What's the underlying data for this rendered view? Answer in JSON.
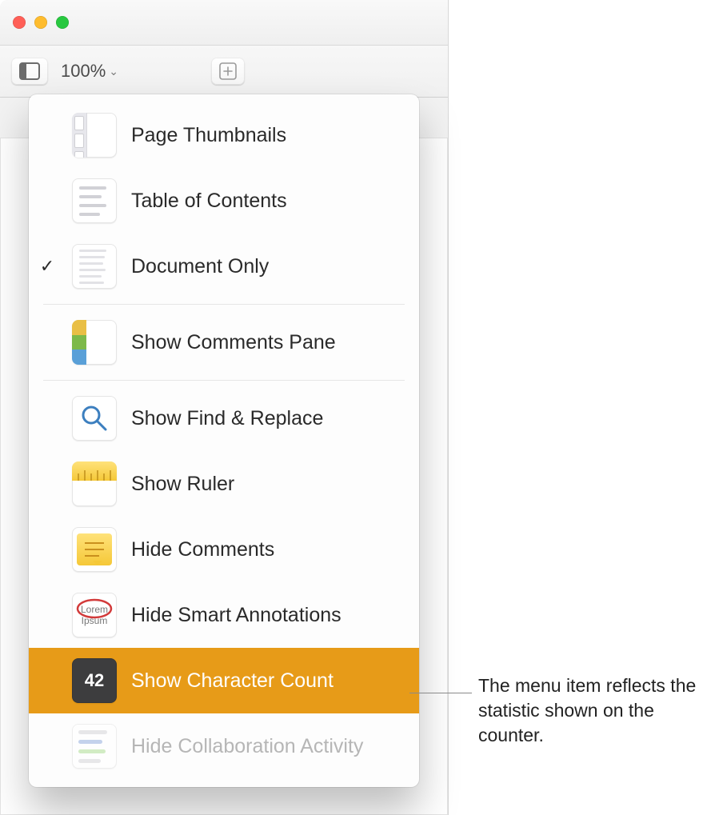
{
  "toolbar": {
    "zoom_level": "100%"
  },
  "view_menu": {
    "page_thumbnails": "Page Thumbnails",
    "table_of_contents": "Table of Contents",
    "document_only": "Document Only",
    "show_comments_pane": "Show Comments Pane",
    "show_find_replace": "Show Find & Replace",
    "show_ruler": "Show Ruler",
    "hide_comments": "Hide Comments",
    "hide_smart_annotations": "Hide Smart Annotations",
    "show_character_count": "Show Character Count",
    "hide_collaboration_activity": "Hide Collaboration Activity",
    "character_count_value": "42",
    "checked_item": "document_only",
    "highlighted_item": "show_character_count",
    "disabled_item": "hide_collaboration_activity"
  },
  "callout": {
    "text": "The menu item reflects the statistic shown on the counter."
  },
  "colors": {
    "highlight": "#e79b18"
  },
  "smart_annot_sample": {
    "line1": "Lorem",
    "line2": "Ipsum"
  }
}
